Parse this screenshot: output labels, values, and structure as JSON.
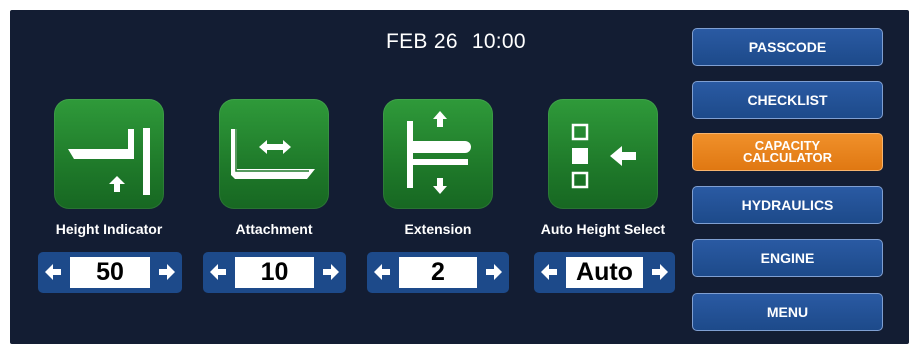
{
  "status": {
    "date": "FEB 26",
    "time": "10:00"
  },
  "tiles": [
    {
      "label": "Height Indicator",
      "icon": "height-indicator-icon"
    },
    {
      "label": "Attachment",
      "icon": "attachment-icon"
    },
    {
      "label": "Extension",
      "icon": "extension-icon"
    },
    {
      "label": "Auto Height Select",
      "icon": "auto-height-select-icon"
    }
  ],
  "steppers": [
    {
      "value": "50"
    },
    {
      "value": "10"
    },
    {
      "value": "2"
    },
    {
      "value": "Auto"
    }
  ],
  "menu": [
    {
      "label": "PASSCODE"
    },
    {
      "label": "CHECKLIST"
    },
    {
      "label_line1": "CAPACITY",
      "label_line2": "CALCULATOR",
      "active": true
    },
    {
      "label": "HYDRAULICS"
    },
    {
      "label": "ENGINE"
    },
    {
      "label": "MENU"
    }
  ],
  "colors": {
    "background": "#131d33",
    "tile_green": "#248a2f",
    "stepper_blue": "#1d4a8a",
    "button_blue": "#1d4a8a",
    "active_orange": "#e8841d"
  }
}
